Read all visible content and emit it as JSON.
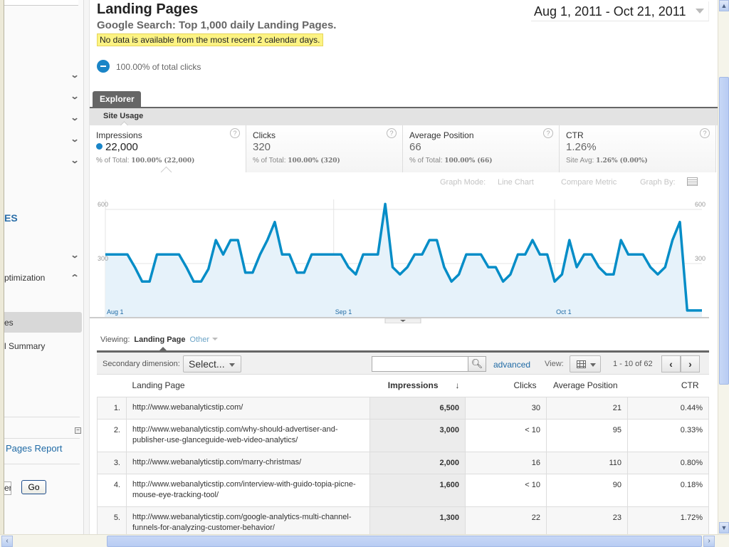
{
  "sidebar": {
    "truncated_heading": "ES",
    "optimization_label": "ptimization",
    "selected_item": "es",
    "summary_item": "l Summary",
    "report_link": "Pages Report",
    "input_value": "er",
    "go_button": "Go"
  },
  "header": {
    "title": "Landing Pages",
    "subtitle": "Google Search: Top 1,000 daily Landing Pages.",
    "notice": "No data is available from the most recent 2 calendar days.",
    "percent_total": "100.00% of total clicks",
    "date_range": "Aug 1, 2011 - Oct 21, 2011"
  },
  "explorer": {
    "tab": "Explorer",
    "subtab": "Site Usage"
  },
  "metrics": [
    {
      "name": "Impressions",
      "value": "22,000",
      "foot_label": "% of Total:",
      "foot_value": "100.00% (22,000)",
      "active": true
    },
    {
      "name": "Clicks",
      "value": "320",
      "foot_label": "% of Total:",
      "foot_value": "100.00% (320)"
    },
    {
      "name": "Average Position",
      "value": "66",
      "foot_label": "% of Total:",
      "foot_value": "100.00% (66)"
    },
    {
      "name": "CTR",
      "value": "1.26%",
      "foot_label": "Site Avg:",
      "foot_value": "1.26% (0.00%)"
    }
  ],
  "graph_controls": {
    "graph_mode_label": "Graph Mode:",
    "graph_mode_value": "Line Chart",
    "compare_metric": "Compare Metric",
    "graph_by": "Graph By:"
  },
  "chart_data": {
    "type": "area",
    "title": "",
    "series": [
      {
        "name": "Impressions",
        "color": "#058dc7",
        "values": [
          350,
          350,
          350,
          350,
          280,
          200,
          200,
          350,
          350,
          350,
          350,
          280,
          200,
          200,
          270,
          430,
          350,
          430,
          430,
          250,
          250,
          350,
          430,
          530,
          350,
          350,
          250,
          250,
          350,
          350,
          350,
          350,
          350,
          280,
          240,
          350,
          350,
          350,
          630,
          280,
          240,
          280,
          350,
          350,
          430,
          430,
          280,
          200,
          240,
          350,
          350,
          350,
          280,
          280,
          200,
          240,
          350,
          350,
          430,
          350,
          350,
          200,
          240,
          430,
          280,
          350,
          350,
          280,
          240,
          240,
          430,
          350,
          350,
          350,
          280,
          240,
          280,
          430,
          530,
          40,
          40,
          40
        ]
      }
    ],
    "x_start": "Aug 1, 2011",
    "x_end": "Oct 21, 2011",
    "x_tick_labels": [
      {
        "label": "Aug 1",
        "index": 0
      },
      {
        "label": "Sep 1",
        "index": 31
      },
      {
        "label": "Oct 1",
        "index": 61
      }
    ],
    "y_tick_labels": [
      "300",
      "600"
    ],
    "ylim": [
      0,
      600
    ],
    "grid": true,
    "xlabel": "",
    "ylabel": ""
  },
  "table_controls": {
    "viewing_label": "Viewing:",
    "primary_dimension": "Landing Page",
    "other": "Other",
    "secondary_label": "Secondary dimension:",
    "secondary_select": "Select...",
    "search_value": "",
    "advanced": "advanced",
    "view_label": "View:",
    "pagination": "1 - 10 of 62",
    "prev": "‹",
    "next": "›"
  },
  "table": {
    "columns": [
      "Landing Page",
      "Impressions",
      "Clicks",
      "Average Position",
      "CTR"
    ],
    "sort_indicator": "↓",
    "rows": [
      {
        "num": "1.",
        "url": "http://www.webanalyticstip.com/",
        "impressions": "6,500",
        "clicks": "30",
        "avg_position": "21",
        "ctr": "0.44%"
      },
      {
        "num": "2.",
        "url": "http://www.webanalyticstip.com/why-should-advertiser-and-publisher-use-glanceguide-web-video-analytics/",
        "impressions": "3,000",
        "clicks": "< 10",
        "avg_position": "95",
        "ctr": "0.33%"
      },
      {
        "num": "3.",
        "url": "http://www.webanalyticstip.com/marry-christmas/",
        "impressions": "2,000",
        "clicks": "16",
        "avg_position": "110",
        "ctr": "0.80%"
      },
      {
        "num": "4.",
        "url": "http://www.webanalyticstip.com/interview-with-guido-topia-picne-mouse-eye-tracking-tool/",
        "impressions": "1,600",
        "clicks": "< 10",
        "avg_position": "90",
        "ctr": "0.18%"
      },
      {
        "num": "5.",
        "url": "http://www.webanalyticstip.com/google-analytics-multi-channel-funnels-for-analyzing-customer-behavior/",
        "impressions": "1,300",
        "clicks": "22",
        "avg_position": "23",
        "ctr": "1.72%"
      }
    ]
  }
}
